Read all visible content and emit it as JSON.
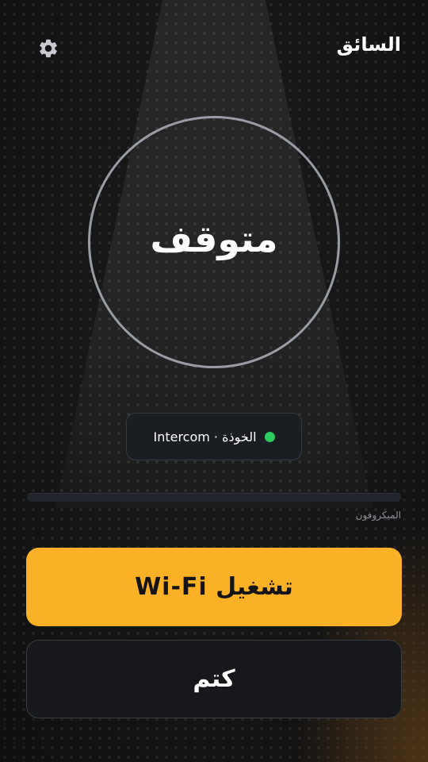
{
  "header": {
    "title": "السائق",
    "settings_icon": "gear-icon"
  },
  "status": {
    "label": "متوقف"
  },
  "connection": {
    "text": "الخوذة · Intercom",
    "indicator_color": "#2ecc5f"
  },
  "microphone": {
    "label": "الميكروفون"
  },
  "actions": {
    "primary_label": "تشغيل Wi-Fi",
    "secondary_label": "كتم"
  },
  "colors": {
    "accent": "#fbb125",
    "background": "#171717"
  }
}
